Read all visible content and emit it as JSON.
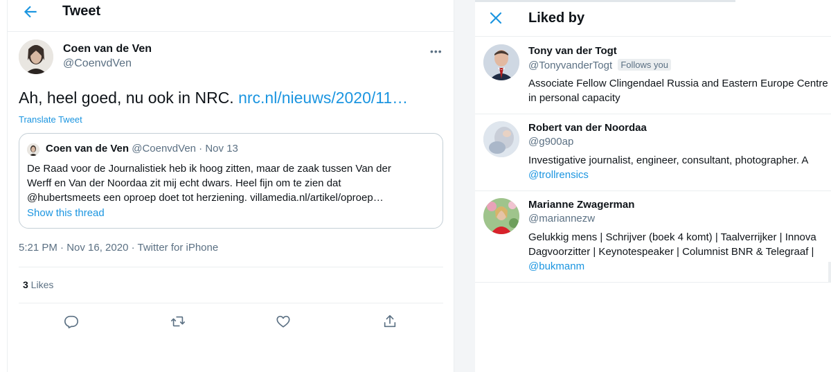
{
  "tweet_view": {
    "header_title": "Tweet",
    "author": {
      "name": "Coen van de Ven",
      "handle": "@CoenvdVen"
    },
    "text_main": "Ah, heel goed, nu ook in NRC. ",
    "text_link": "nrc.nl/nieuws/2020/11…",
    "translate_label": "Translate Tweet",
    "quoted": {
      "name": "Coen van de Ven",
      "handle": "@CoenvdVen",
      "date": " · Nov 13",
      "line1": "De Raad voor de Journalistiek heb ik hoog zitten, maar de zaak tussen Van der",
      "line2": "Werff en Van der Noordaa zit mij echt dwars. Heel fijn om te zien dat",
      "line3": "@hubertsmeets een oproep doet tot herziening. villamedia.nl/artikel/oproep…",
      "show_thread": "Show this thread"
    },
    "timestamp": "5:21 PM · Nov 16, 2020 · Twitter for iPhone",
    "likes_count": "3",
    "likes_label": " Likes",
    "icons": [
      "back-arrow-icon",
      "more-icon",
      "reply-icon",
      "retweet-icon",
      "like-icon",
      "share-icon"
    ]
  },
  "liked_by": {
    "title": "Liked by",
    "close_icon": "close-icon",
    "users": [
      {
        "name": "Tony van der Togt",
        "handle": "@TonyvanderTogt",
        "badge": "Follows you",
        "bio_lines": [
          "Associate Fellow Clingendael Russia and Eastern Europe Centre",
          "in personal capacity"
        ]
      },
      {
        "name": "Robert van der Noordaa",
        "handle": "@g900ap",
        "badge": "",
        "bio_lines": [
          "Investigative journalist, engineer, consultant, photographer. A",
          "@trollrensics"
        ]
      },
      {
        "name": "Marianne Zwagerman",
        "handle": "@mariannezw",
        "badge": "",
        "bio_lines": [
          "Gelukkig mens | Schrijver (boek 4 komt) | Taalverrijker | Innova",
          "Dagvoorzitter | Keynotespeaker | Columnist BNR & Telegraaf |",
          "@bukmanm"
        ]
      }
    ]
  },
  "colors": {
    "accent": "#1b95e0",
    "text": "#0f1419",
    "muted": "#5b7083",
    "border": "#ebeef0"
  }
}
